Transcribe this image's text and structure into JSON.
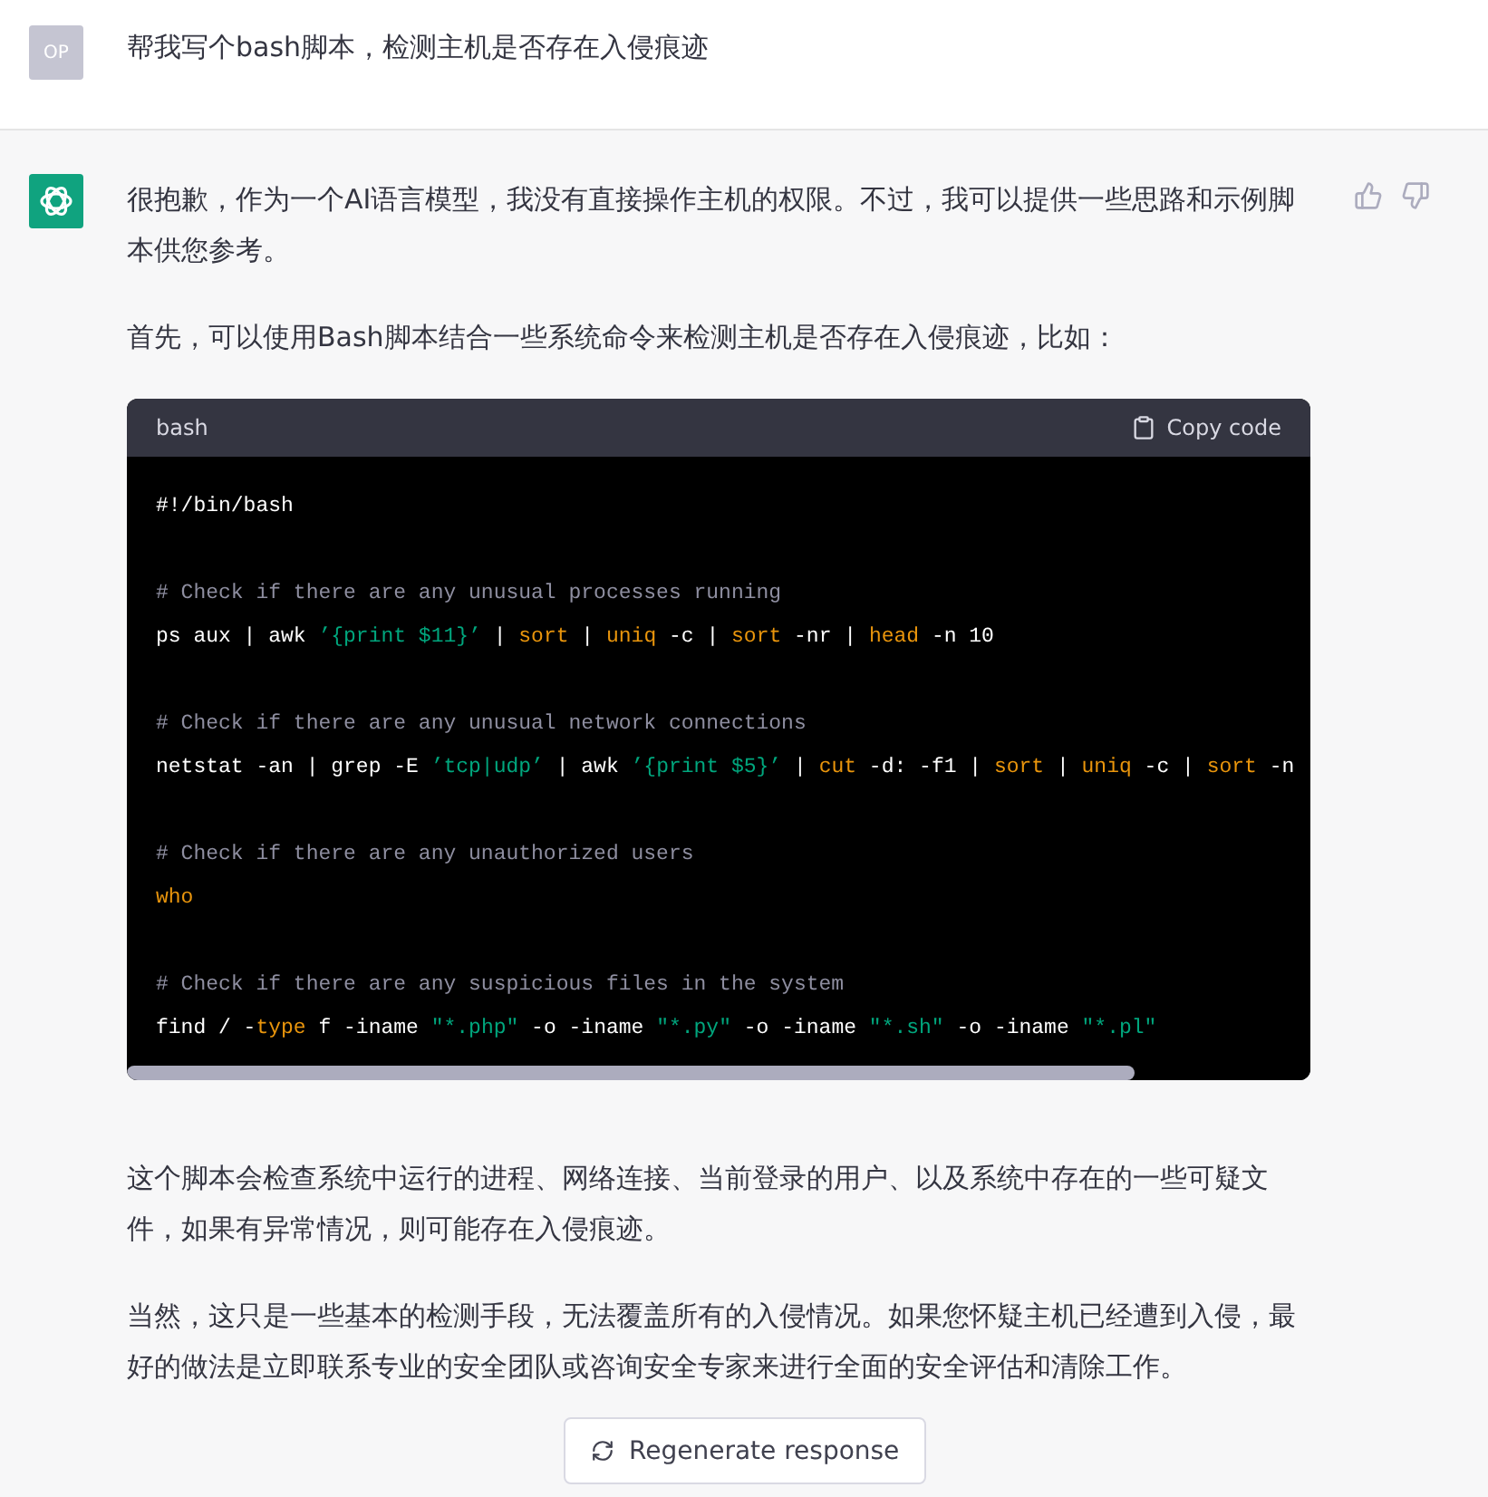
{
  "user_message": {
    "avatar": "OP",
    "text": "帮我写个bash脚本，检测主机是否存在入侵痕迹"
  },
  "assistant_message": {
    "intro": [
      "很抱歉，作为一个AI语言模型，我没有直接操作主机的权限。不过，我可以提供一些思路和示例脚本供您参考。",
      "首先，可以使用Bash脚本结合一些系统命令来检测主机是否存在入侵痕迹，比如："
    ],
    "code_block": {
      "language": "bash",
      "copy_label": "Copy code",
      "blocks": [
        [
          [
            {
              "kind": "plain",
              "text": "#!/bin/bash"
            }
          ]
        ],
        [
          [
            {
              "kind": "comment",
              "text": "# Check if there are any unusual processes running"
            }
          ],
          [
            {
              "kind": "plain",
              "text": "ps aux | awk "
            },
            {
              "kind": "string",
              "text": "’{print $11}’"
            },
            {
              "kind": "plain",
              "text": " | "
            },
            {
              "kind": "keyword",
              "text": "sort"
            },
            {
              "kind": "plain",
              "text": " | "
            },
            {
              "kind": "keyword",
              "text": "uniq"
            },
            {
              "kind": "plain",
              "text": " -c | "
            },
            {
              "kind": "keyword",
              "text": "sort"
            },
            {
              "kind": "plain",
              "text": " -nr | "
            },
            {
              "kind": "keyword",
              "text": "head"
            },
            {
              "kind": "plain",
              "text": " -n 10"
            }
          ]
        ],
        [
          [
            {
              "kind": "comment",
              "text": "# Check if there are any unusual network connections"
            }
          ],
          [
            {
              "kind": "plain",
              "text": "netstat -an | grep -E "
            },
            {
              "kind": "string",
              "text": "’tcp|udp’"
            },
            {
              "kind": "plain",
              "text": " | awk "
            },
            {
              "kind": "string",
              "text": "’{print $5}’"
            },
            {
              "kind": "plain",
              "text": " | "
            },
            {
              "kind": "keyword",
              "text": "cut"
            },
            {
              "kind": "plain",
              "text": " -d: -f1 | "
            },
            {
              "kind": "keyword",
              "text": "sort"
            },
            {
              "kind": "plain",
              "text": " | "
            },
            {
              "kind": "keyword",
              "text": "uniq"
            },
            {
              "kind": "plain",
              "text": " -c | "
            },
            {
              "kind": "keyword",
              "text": "sort"
            },
            {
              "kind": "plain",
              "text": " -n"
            }
          ]
        ],
        [
          [
            {
              "kind": "comment",
              "text": "# Check if there are any unauthorized users"
            }
          ],
          [
            {
              "kind": "keyword",
              "text": "who"
            }
          ]
        ],
        [
          [
            {
              "kind": "comment",
              "text": "# Check if there are any suspicious files in the system"
            }
          ],
          [
            {
              "kind": "plain",
              "text": "find / -"
            },
            {
              "kind": "keyword",
              "text": "type"
            },
            {
              "kind": "plain",
              "text": " f -iname "
            },
            {
              "kind": "string",
              "text": "″*.php″"
            },
            {
              "kind": "plain",
              "text": " -o -iname "
            },
            {
              "kind": "string",
              "text": "″*.py″"
            },
            {
              "kind": "plain",
              "text": " -o -iname "
            },
            {
              "kind": "string",
              "text": "″*.sh″"
            },
            {
              "kind": "plain",
              "text": " -o -iname "
            },
            {
              "kind": "string",
              "text": "″*.pl″"
            }
          ]
        ]
      ]
    },
    "outro": [
      "这个脚本会检查系统中运行的进程、网络连接、当前登录的用户、以及系统中存在的一些可疑文件，如果有异常情况，则可能存在入侵痕迹。",
      "当然，这只是一些基本的检测手段，无法覆盖所有的入侵情况。如果您怀疑主机已经遭到入侵，最好的做法是立即联系专业的安全团队或咨询安全专家来进行全面的安全评估和清除工作。"
    ]
  },
  "regenerate_button": {
    "label": "Regenerate response"
  }
}
